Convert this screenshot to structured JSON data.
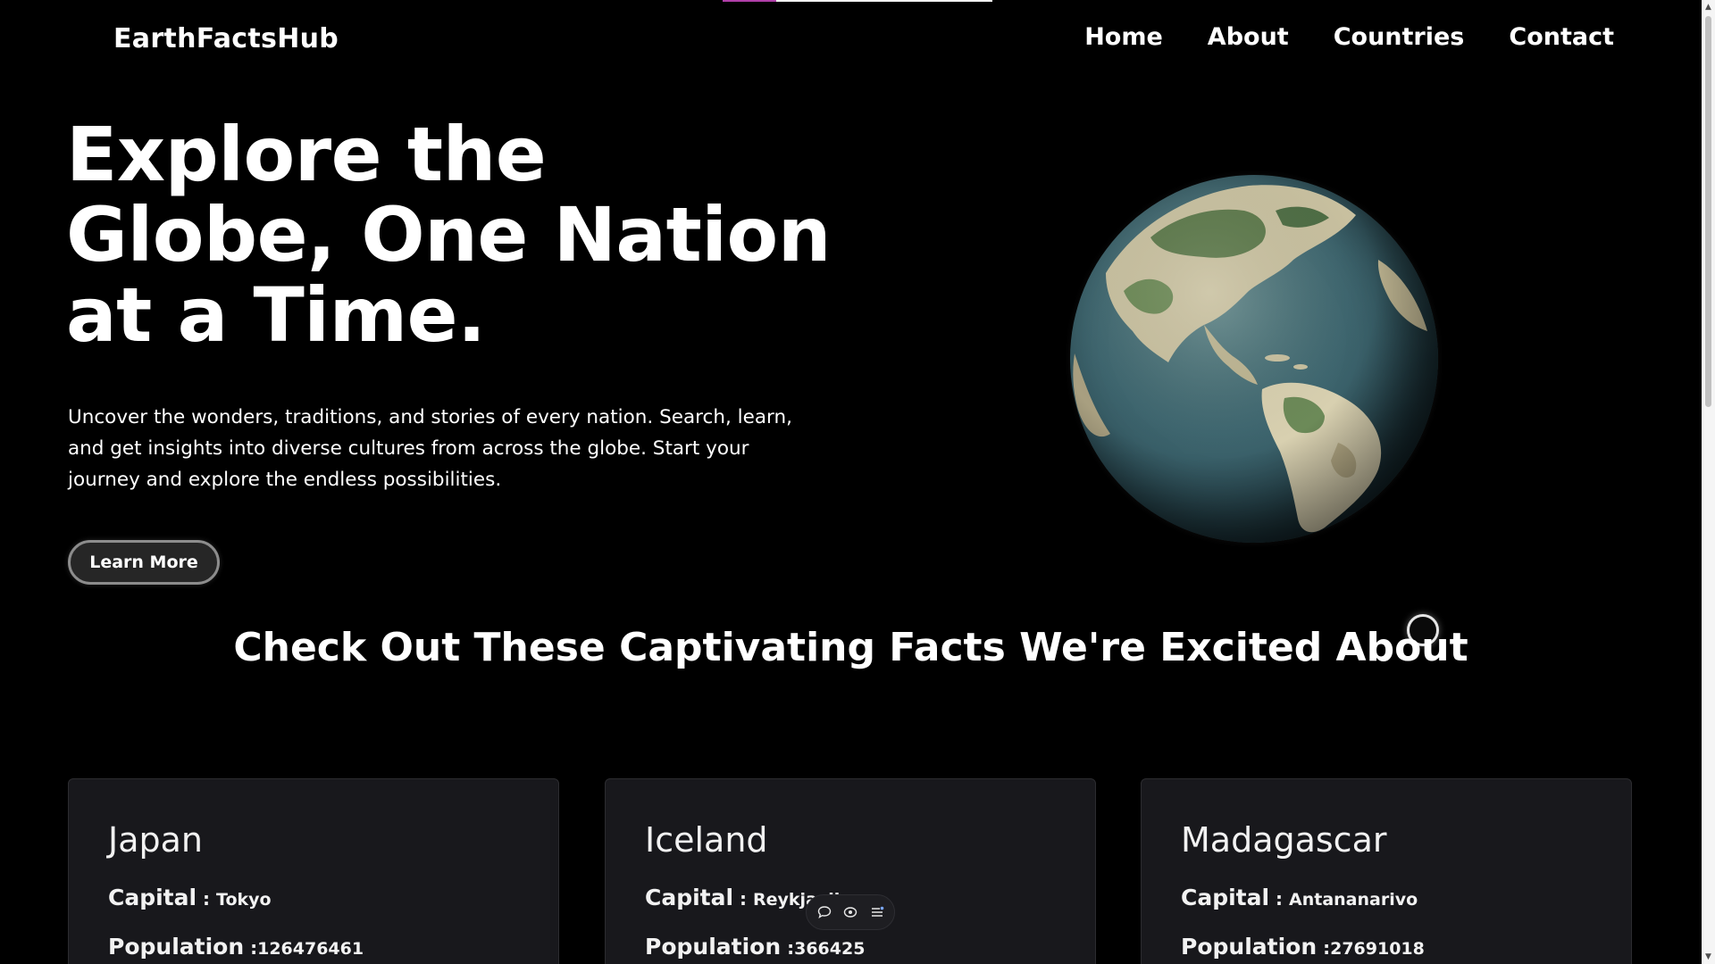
{
  "brand": {
    "name": "EarthFactsHub"
  },
  "nav": {
    "items": [
      {
        "label": "Home"
      },
      {
        "label": "About"
      },
      {
        "label": "Countries"
      },
      {
        "label": "Contact"
      }
    ]
  },
  "hero": {
    "title": "Explore the Globe, One Nation at a Time.",
    "description": "Uncover the wonders, traditions, and stories of every nation. Search, learn, and get insights into diverse cultures from across the globe. Start your journey and explore the endless possibilities.",
    "cta_label": "Learn More",
    "image_icon": "globe-earth-image"
  },
  "facts": {
    "heading": "Check Out These Captivating Facts We're Excited About",
    "capital_label": "Capital",
    "population_label": "Population",
    "countries": [
      {
        "name": "Japan",
        "capital": "Tokyo",
        "population": "126476461"
      },
      {
        "name": "Iceland",
        "capital": "Reykjavik",
        "population": "366425"
      },
      {
        "name": "Madagascar",
        "capital": "Antananarivo",
        "population": "27691018"
      }
    ]
  },
  "toolbar": {
    "icons": [
      "comment-icon",
      "eye-icon",
      "list-icon"
    ]
  },
  "loading_progress": 0.2,
  "colors": {
    "background": "#000000",
    "text": "#ffffff",
    "card_background": "#18181c",
    "button_background": "#262626",
    "button_border": "#8c8c8c",
    "progress_accent": "#b03fa8"
  }
}
